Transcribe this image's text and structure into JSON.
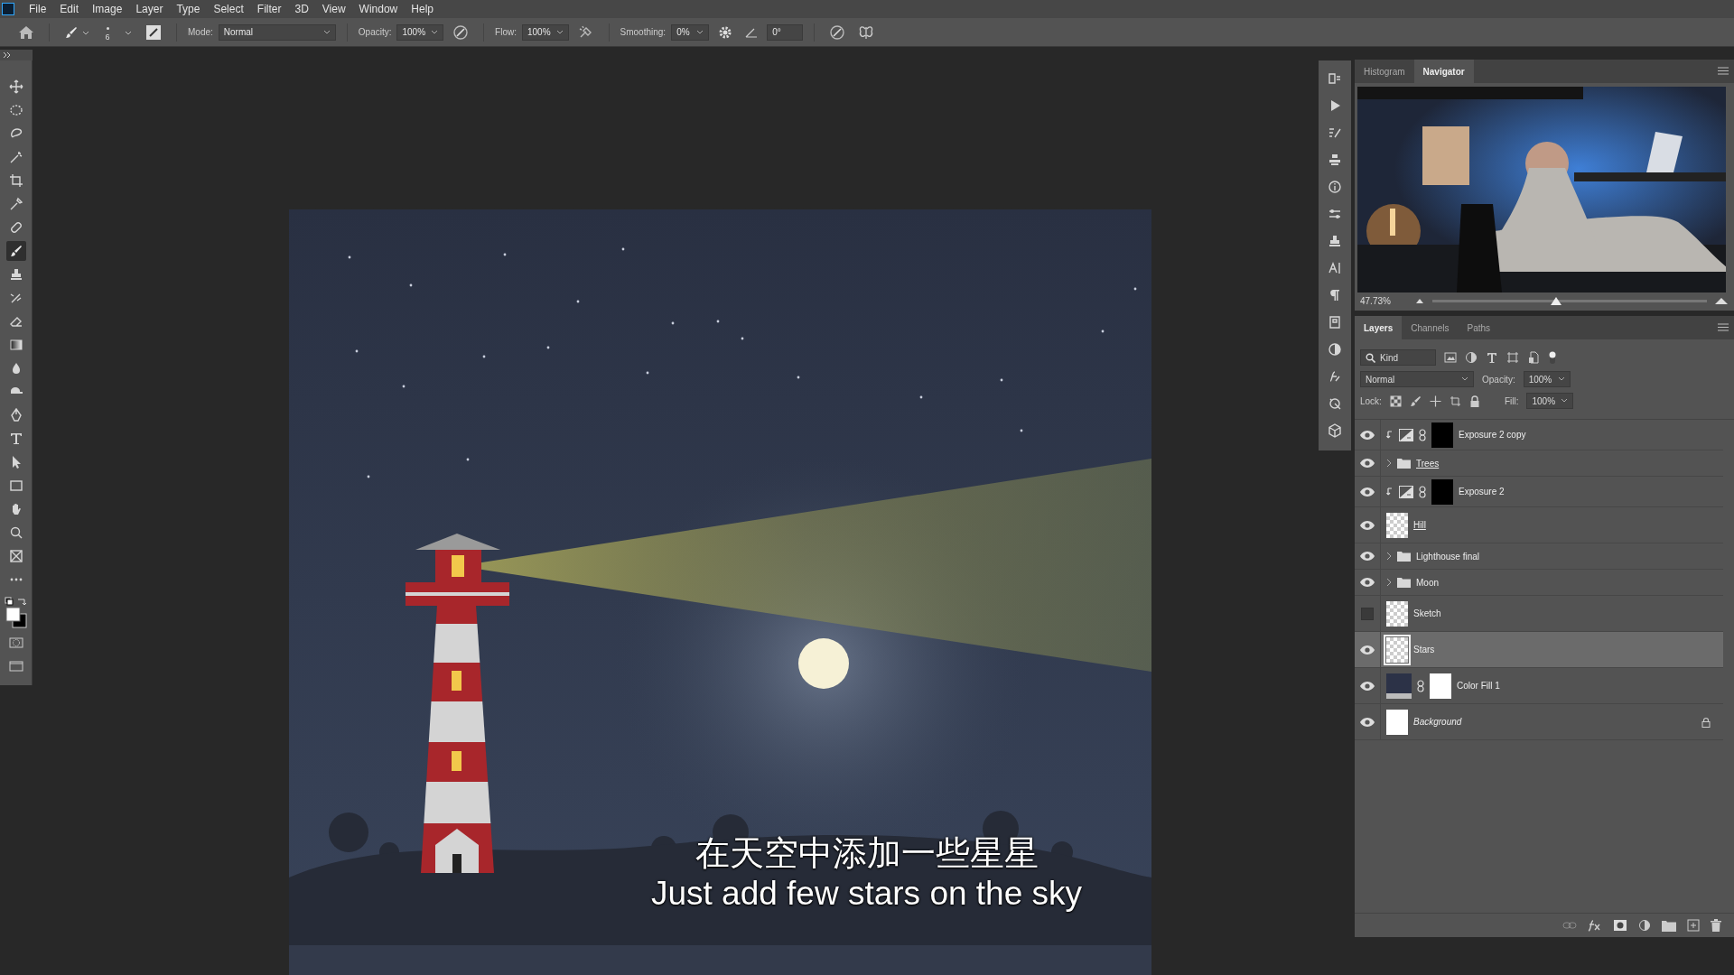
{
  "menu": [
    "File",
    "Edit",
    "Image",
    "Layer",
    "Type",
    "Select",
    "Filter",
    "3D",
    "View",
    "Window",
    "Help"
  ],
  "options": {
    "brush_size": "6",
    "mode_label": "Mode:",
    "mode": "Normal",
    "opacity_label": "Opacity:",
    "opacity": "100%",
    "flow_label": "Flow:",
    "flow": "100%",
    "smoothing_label": "Smoothing:",
    "smoothing": "0%",
    "angle": "0°"
  },
  "tools": [
    {
      "kind": "move",
      "selected": false
    },
    {
      "kind": "marquee",
      "selected": false
    },
    {
      "kind": "lasso",
      "selected": false
    },
    {
      "kind": "wand",
      "selected": false
    },
    {
      "kind": "crop",
      "selected": false
    },
    {
      "kind": "eyedropper",
      "selected": false
    },
    {
      "kind": "healing",
      "selected": false
    },
    {
      "kind": "brush",
      "selected": true
    },
    {
      "kind": "stamp",
      "selected": false
    },
    {
      "kind": "history",
      "selected": false
    },
    {
      "kind": "eraser",
      "selected": false
    },
    {
      "kind": "gradient",
      "selected": false
    },
    {
      "kind": "blur",
      "selected": false
    },
    {
      "kind": "dodge",
      "selected": false
    },
    {
      "kind": "pen",
      "selected": false
    },
    {
      "kind": "type",
      "selected": false
    },
    {
      "kind": "select",
      "selected": false
    },
    {
      "kind": "rectangle",
      "selected": false
    },
    {
      "kind": "hand",
      "selected": false
    },
    {
      "kind": "zoom",
      "selected": false
    },
    {
      "kind": "frame",
      "selected": false
    },
    {
      "kind": "more",
      "selected": false
    }
  ],
  "canvas": {
    "subtitle_zh": "在天空中添加一些星星",
    "subtitle_en": "Just add few stars on the sky"
  },
  "navigator": {
    "tabs": [
      {
        "label": "Histogram",
        "selected": false
      },
      {
        "label": "Navigator",
        "selected": true
      }
    ],
    "zoom": "47.73%",
    "level": 0.45
  },
  "layers_panel": {
    "tabs": [
      {
        "label": "Layers",
        "selected": true
      },
      {
        "label": "Channels",
        "selected": false
      },
      {
        "label": "Paths",
        "selected": false
      }
    ],
    "filter": "Kind",
    "blend_mode": "Normal",
    "opacity_label": "Opacity:",
    "opacity": "100%",
    "lock_label": "Lock:",
    "fill_label": "Fill:",
    "fill": "100%",
    "layers": [
      {
        "kind": "adjustment",
        "name": "Exposure 2 copy",
        "visible": true,
        "selected": false,
        "underlined": false,
        "italic": false,
        "locked": false
      },
      {
        "kind": "group",
        "name": "Trees",
        "visible": true,
        "selected": false,
        "underlined": true,
        "italic": false,
        "locked": false
      },
      {
        "kind": "adjustment",
        "name": "Exposure 2",
        "visible": true,
        "selected": false,
        "underlined": false,
        "italic": false,
        "locked": false
      },
      {
        "kind": "pixel",
        "name": "Hill",
        "visible": true,
        "selected": false,
        "underlined": true,
        "italic": false,
        "locked": false
      },
      {
        "kind": "group",
        "name": "Lighthouse final",
        "visible": true,
        "selected": false,
        "underlined": false,
        "italic": false,
        "locked": false
      },
      {
        "kind": "group",
        "name": "Moon",
        "visible": true,
        "selected": false,
        "underlined": false,
        "italic": false,
        "locked": false
      },
      {
        "kind": "pixel",
        "name": "Sketch",
        "visible": false,
        "selected": false,
        "underlined": false,
        "italic": false,
        "locked": false
      },
      {
        "kind": "pixel",
        "name": "Stars",
        "visible": true,
        "selected": true,
        "underlined": false,
        "italic": false,
        "locked": false
      },
      {
        "kind": "fill",
        "name": "Color Fill 1",
        "visible": true,
        "selected": false,
        "underlined": false,
        "italic": false,
        "locked": false
      },
      {
        "kind": "pixel",
        "name": "Background",
        "visible": true,
        "selected": false,
        "underlined": false,
        "italic": true,
        "locked": true
      }
    ]
  }
}
